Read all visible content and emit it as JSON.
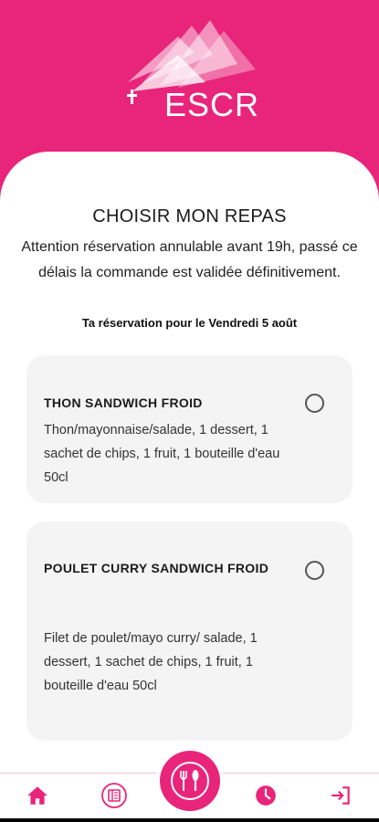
{
  "app": {
    "logo_text": "ESCR",
    "accent_color": "#e8257a"
  },
  "page": {
    "title": "CHOISIR MON REPAS",
    "notice": "Attention réservation annulable avant 19h, passé ce délais la commande est validée définitivement.",
    "date_line": "Ta réservation pour le Vendredi 5 août"
  },
  "meals": [
    {
      "name": "THON SANDWICH FROID",
      "description": "Thon/mayonnaise/salade, 1 dessert, 1 sachet de chips, 1 fruit, 1 bouteille d'eau 50cl",
      "selected": false
    },
    {
      "name": "POULET CURRY SANDWICH FROID",
      "description": "Filet de poulet/mayo curry/ salade, 1 dessert, 1 sachet de chips, 1 fruit, 1 bouteille d'eau 50cl",
      "selected": false
    }
  ],
  "nav": {
    "items": [
      {
        "icon": "home-icon"
      },
      {
        "icon": "menu-book-icon"
      },
      {
        "icon": "cutlery-icon",
        "active": true
      },
      {
        "icon": "clock-icon"
      },
      {
        "icon": "logout-icon"
      }
    ]
  }
}
